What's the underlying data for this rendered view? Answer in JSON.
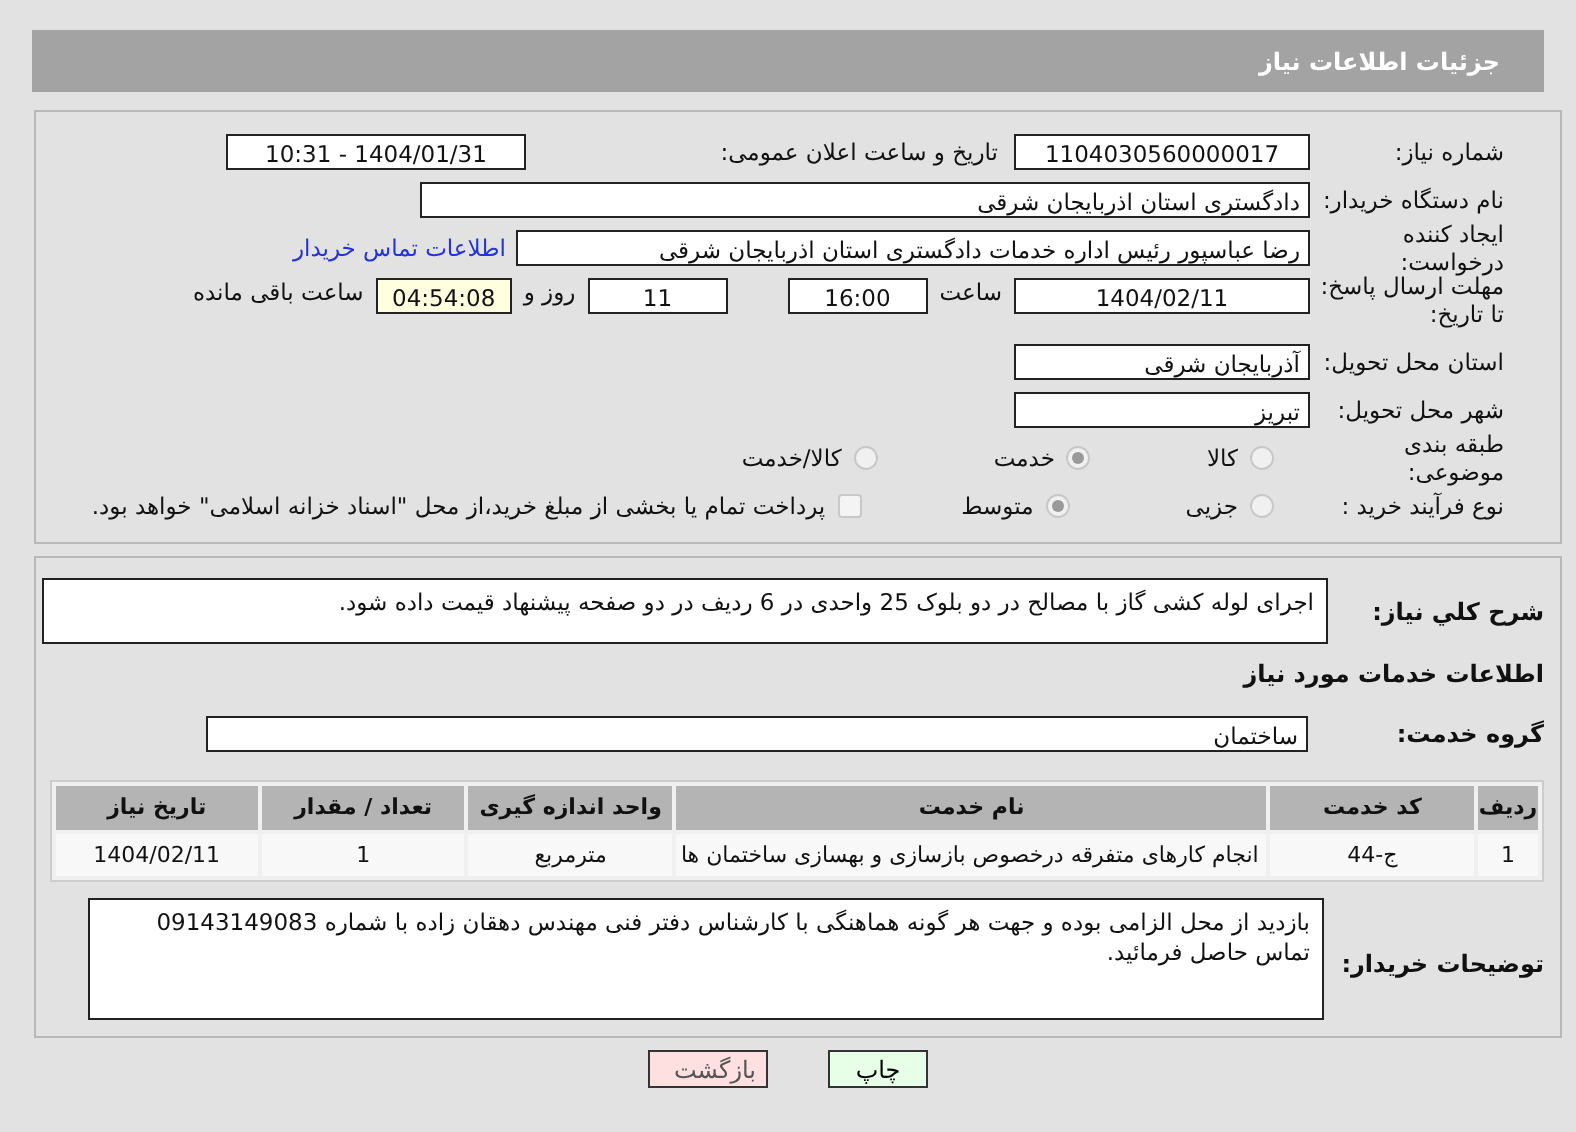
{
  "header": {
    "title": "جزئیات اطلاعات نیاز"
  },
  "need_number": {
    "label": "شماره نیاز:",
    "value": "1104030560000017"
  },
  "announce": {
    "label": "تاریخ و ساعت اعلان عمومی:",
    "value": "1404/01/31 - 10:31"
  },
  "buyer": {
    "label": "نام دستگاه خریدار:",
    "value": "دادگستری استان اذربایجان شرقی"
  },
  "requester": {
    "label": "ایجاد کننده درخواست:",
    "value": "رضا عباسپور رئیس اداره خدمات دادگستری استان اذربایجان شرقی",
    "link": "اطلاعات تماس خریدار"
  },
  "deadline": {
    "label": "مهلت ارسال پاسخ: تا تاریخ:",
    "date": "1404/02/11",
    "time_label": "ساعت",
    "time": "16:00",
    "days": "11",
    "days_label": "روز و",
    "remaining": "04:54:08",
    "remaining_label": "ساعت باقی مانده"
  },
  "province": {
    "label": "استان محل تحویل:",
    "value": "آذربایجان شرقی"
  },
  "city": {
    "label": "شهر محل تحویل:",
    "value": "تبریز"
  },
  "category": {
    "label": "طبقه بندی موضوعی:",
    "options": [
      {
        "label": "کالا",
        "selected": false
      },
      {
        "label": "خدمت",
        "selected": true
      },
      {
        "label": "کالا/خدمت",
        "selected": false
      }
    ]
  },
  "process": {
    "label": "نوع فرآیند خرید :",
    "options": [
      {
        "label": "جزیی",
        "selected": false
      },
      {
        "label": "متوسط",
        "selected": true
      }
    ],
    "payment": {
      "checked": false,
      "text": "پرداخت تمام یا بخشی از مبلغ خرید،از محل \"اسناد خزانه اسلامی\" خواهد بود."
    }
  },
  "description": {
    "label": "شرح كلي نياز:",
    "value": "اجرای لوله کشی گاز با مصالح در دو بلوک 25 واحدی در 6 ردیف در دو صفحه پیشنهاد قیمت داده شود."
  },
  "services": {
    "title": "اطلاعات خدمات مورد نیاز",
    "group_label": "گروه خدمت:",
    "group": "ساختمان",
    "table": {
      "columns": [
        "ردیف",
        "کد خدمت",
        "نام خدمت",
        "واحد اندازه گیری",
        "تعداد / مقدار",
        "تاریخ نیاز"
      ],
      "rows": [
        [
          "1",
          "ج-44",
          "انجام کارهای متفرقه درخصوص بازسازی و بهسازی ساختمان ها",
          "مترمربع",
          "1",
          "1404/02/11"
        ]
      ]
    }
  },
  "buyer_notes": {
    "label": "توضیحات خریدار:",
    "value": "بازدید از محل الزامی بوده و جهت هر گونه هماهنگی با کارشناس دفتر فنی مهندس دهقان زاده با شماره 09143149083 تماس حاصل فرمائید."
  },
  "buttons": [
    {
      "kind": "print",
      "label": "چاپ"
    },
    {
      "kind": "back",
      "label": "بازگشت"
    }
  ]
}
